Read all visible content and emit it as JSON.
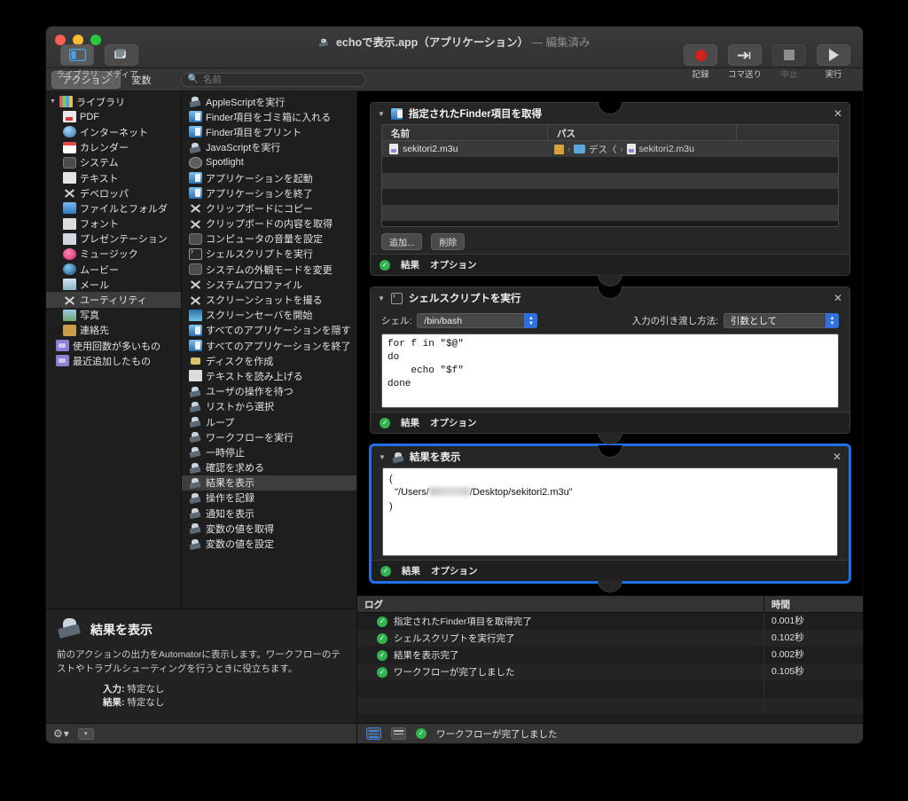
{
  "window": {
    "title_app": "echoで表示.app（アプリケーション）",
    "title_edited": "— 編集済み",
    "doc_icon": "automator-robot-icon"
  },
  "toolbar": {
    "view_buttons": [
      {
        "label": "ライブラリ",
        "icon": "library-panel-icon",
        "active": true
      },
      {
        "label": "メディア",
        "icon": "media-browser-icon",
        "active": false
      }
    ],
    "run_buttons": [
      {
        "label": "記録",
        "icon": "record-dot-icon",
        "enabled": true
      },
      {
        "label": "コマ送り",
        "icon": "step-arrow-icon",
        "enabled": true
      },
      {
        "label": "中止",
        "icon": "stop-square-icon",
        "enabled": false
      },
      {
        "label": "実行",
        "icon": "play-triangle-icon",
        "enabled": true
      }
    ]
  },
  "segmented": {
    "tabs": [
      {
        "label": "アクション",
        "active": true
      },
      {
        "label": "変数",
        "active": false
      }
    ],
    "search_placeholder": "名前",
    "search_value": "",
    "search_icon": "search-icon"
  },
  "library": {
    "root": {
      "label": "ライブラリ",
      "icon": "library-icon",
      "expanded": true
    },
    "items": [
      {
        "label": "PDF",
        "icon": "pdf-icon"
      },
      {
        "label": "インターネット",
        "icon": "internet-icon"
      },
      {
        "label": "カレンダー",
        "icon": "calendar-icon"
      },
      {
        "label": "システム",
        "icon": "system-icon"
      },
      {
        "label": "テキスト",
        "icon": "text-icon"
      },
      {
        "label": "デベロッパ",
        "icon": "developer-icon"
      },
      {
        "label": "ファイルとフォルダ",
        "icon": "files-folders-icon"
      },
      {
        "label": "フォント",
        "icon": "font-icon"
      },
      {
        "label": "プレゼンテーション",
        "icon": "presentation-icon"
      },
      {
        "label": "ミュージック",
        "icon": "music-icon"
      },
      {
        "label": "ムービー",
        "icon": "movie-icon"
      },
      {
        "label": "メール",
        "icon": "mail-icon"
      },
      {
        "label": "ユーティリティ",
        "icon": "utilities-icon",
        "selected": true
      },
      {
        "label": "写真",
        "icon": "photos-icon"
      },
      {
        "label": "連絡先",
        "icon": "contacts-icon"
      }
    ],
    "smart_groups": [
      {
        "label": "使用回数が多いもの",
        "icon": "smart-group-icon"
      },
      {
        "label": "最近追加したもの",
        "icon": "smart-group-icon"
      }
    ]
  },
  "actions_list": [
    {
      "label": "AppleScriptを実行",
      "icon": "automator-robot-icon"
    },
    {
      "label": "Finder項目をゴミ箱に入れる",
      "icon": "finder-icon"
    },
    {
      "label": "Finder項目をプリント",
      "icon": "finder-icon"
    },
    {
      "label": "JavaScriptを実行",
      "icon": "automator-robot-icon"
    },
    {
      "label": "Spotlight",
      "icon": "spotlight-icon"
    },
    {
      "label": "アプリケーションを起動",
      "icon": "finder-icon"
    },
    {
      "label": "アプリケーションを終了",
      "icon": "finder-icon"
    },
    {
      "label": "クリップボードにコピー",
      "icon": "developer-icon"
    },
    {
      "label": "クリップボードの内容を取得",
      "icon": "developer-icon"
    },
    {
      "label": "コンピュータの音量を設定",
      "icon": "system-icon"
    },
    {
      "label": "シェルスクリプトを実行",
      "icon": "terminal-icon"
    },
    {
      "label": "システムの外観モードを変更",
      "icon": "system-icon"
    },
    {
      "label": "システムプロファイル",
      "icon": "developer-icon"
    },
    {
      "label": "スクリーンショットを撮る",
      "icon": "developer-icon"
    },
    {
      "label": "スクリーンセーバを開始",
      "icon": "screensaver-icon"
    },
    {
      "label": "すべてのアプリケーションを隠す",
      "icon": "finder-icon"
    },
    {
      "label": "すべてのアプリケーションを終了",
      "icon": "finder-icon"
    },
    {
      "label": "ディスクを作成",
      "icon": "disk-icon"
    },
    {
      "label": "テキストを読み上げる",
      "icon": "speak-text-icon"
    },
    {
      "label": "ユーザの操作を待つ",
      "icon": "automator-robot-icon"
    },
    {
      "label": "リストから選択",
      "icon": "automator-robot-icon"
    },
    {
      "label": "ループ",
      "icon": "automator-robot-icon"
    },
    {
      "label": "ワークフローを実行",
      "icon": "automator-robot-icon"
    },
    {
      "label": "一時停止",
      "icon": "automator-robot-icon"
    },
    {
      "label": "確認を求める",
      "icon": "automator-robot-icon"
    },
    {
      "label": "結果を表示",
      "icon": "automator-robot-icon",
      "selected": true
    },
    {
      "label": "操作を記録",
      "icon": "automator-robot-icon"
    },
    {
      "label": "通知を表示",
      "icon": "automator-robot-icon"
    },
    {
      "label": "変数の値を取得",
      "icon": "automator-robot-icon"
    },
    {
      "label": "変数の値を設定",
      "icon": "automator-robot-icon"
    }
  ],
  "description": {
    "icon": "automator-robot-icon",
    "title": "結果を表示",
    "body": "前のアクションの出力をAutomatorに表示します。ワークフローのテストやトラブルシューティングを行うときに役立ちます。",
    "input_label": "入力:",
    "input_value": "特定なし",
    "result_label": "結果:",
    "result_value": "特定なし",
    "gear_icon": "gear-icon",
    "gear_caret": "chevron-down-icon",
    "extra_icon": "disclosure-box-icon"
  },
  "workflow": {
    "footer_result": "結果",
    "footer_options": "オプション",
    "close_icon": "close-icon",
    "disclosure_icon": "disclosure-triangle-icon",
    "actions": [
      {
        "title": "指定されたFinder項目を取得",
        "icon": "finder-icon",
        "selected": false,
        "table": {
          "columns": [
            "名前",
            "パス",
            ""
          ],
          "rows": [
            {
              "name": "sekitori2.m3u",
              "path_crumbs": [
                "デス〈",
                "sekitori2.m3u"
              ],
              "name_icon": "file-icon",
              "home_icon": "home-folder-icon",
              "folder_icon": "folder-icon",
              "file_icon": "file-icon"
            }
          ]
        },
        "buttons": [
          {
            "label": "追加..."
          },
          {
            "label": "削除"
          }
        ]
      },
      {
        "title": "シェルスクリプトを実行",
        "icon": "terminal-icon",
        "selected": false,
        "shell_label": "シェル:",
        "shell_value": "/bin/bash",
        "pass_label": "入力の引き渡し方法:",
        "pass_value": "引数として",
        "script": "for f in \"$@\"\ndo\n    echo \"$f\"\ndone"
      },
      {
        "title": "結果を表示",
        "icon": "automator-robot-icon",
        "selected": true,
        "result_line1": "(",
        "result_prefix": "  \"/Users/",
        "result_suffix": "/Desktop/sekitori2.m3u\"",
        "result_line3": ")"
      }
    ]
  },
  "log": {
    "columns": [
      "ログ",
      "時間"
    ],
    "rows": [
      {
        "message": "指定されたFinder項目を取得完了",
        "time": "0.001秒",
        "status": "ok"
      },
      {
        "message": "シェルスクリプトを実行完了",
        "time": "0.102秒",
        "status": "ok"
      },
      {
        "message": "結果を表示完了",
        "time": "0.002秒",
        "status": "ok"
      },
      {
        "message": "ワークフローが完了しました",
        "time": "0.105秒",
        "status": "ok"
      }
    ]
  },
  "status_bar": {
    "log_view_icon": "log-list-view-icon",
    "split_view_icon": "split-view-icon",
    "status_icon": "check-circle-icon",
    "message": "ワークフローが完了しました"
  },
  "colors": {
    "accent_blue": "#1f6feb",
    "success_green": "#30b350",
    "record_red": "#d0211c",
    "window_bg": "#2b2b2b",
    "canvas_bg": "#000000"
  }
}
